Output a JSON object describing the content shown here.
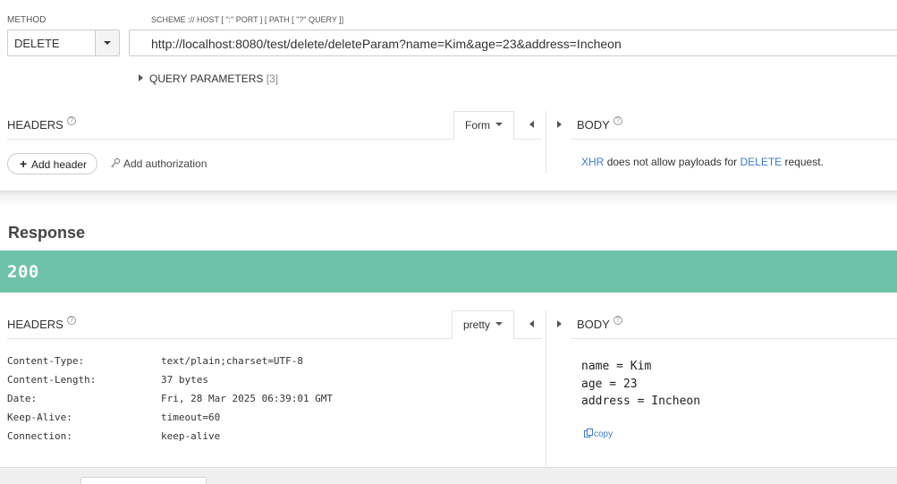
{
  "request": {
    "method_label": "METHOD",
    "method_value": "DELETE",
    "url_label": "SCHEME :// HOST [ \":\" PORT ] [ PATH [ \"?\" QUERY ]]",
    "url_value": "http://localhost:8080/test/delete/deleteParam?name=Kim&age=23&address=Incheon",
    "query_params_label": "QUERY PARAMETERS",
    "query_params_count": "[3]",
    "headers": {
      "title": "HEADERS",
      "help": "?",
      "mode": "Form",
      "add_header": "Add header",
      "add_auth": "Add authorization"
    },
    "body": {
      "title": "BODY",
      "help": "?",
      "message_prefix": "XHR",
      "message_middle": "does not allow payloads for",
      "message_method": "DELETE",
      "message_suffix": "request."
    }
  },
  "response": {
    "title": "Response",
    "status_code": "200",
    "headers": {
      "title": "HEADERS",
      "help": "?",
      "mode": "pretty",
      "rows": [
        {
          "key": "Content-Type:",
          "value": "text/plain;charset=UTF-8"
        },
        {
          "key": "Content-Length:",
          "value": "37 bytes"
        },
        {
          "key": "Date:",
          "value": "Fri, 28 Mar 2025 06:39:01 GMT"
        },
        {
          "key": "Keep-Alive:",
          "value": "timeout=60"
        },
        {
          "key": "Connection:",
          "value": "keep-alive"
        }
      ]
    },
    "body": {
      "title": "BODY",
      "help": "?",
      "lines": [
        "name = Kim",
        "age = 23",
        "address = Incheon"
      ],
      "copy_label": "copy"
    }
  },
  "colors": {
    "status_ok": "#6ec2a8",
    "link": "#3a7bc8"
  },
  "icons": {
    "method_dropdown": "chevron-down-icon",
    "query_expand": "caret-right-icon",
    "help": "help-circle-icon",
    "add": "plus-icon",
    "authorization": "key-icon",
    "collapse_left": "caret-left-icon",
    "expand_right": "caret-right-icon",
    "copy": "copy-icon"
  }
}
